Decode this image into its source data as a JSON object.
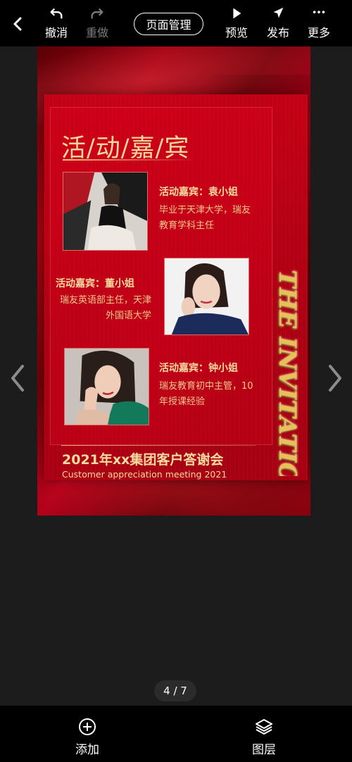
{
  "toolbar": {
    "undo_label": "撤消",
    "redo_label": "重做",
    "page_manage_label": "页面管理",
    "preview_label": "预览",
    "publish_label": "发布",
    "more_label": "更多"
  },
  "poster": {
    "title": "活/动/嘉/宾",
    "guests": [
      {
        "name": "活动嘉宾：袁小姐",
        "desc": "毕业于天津大学，瑞友教育学科主任"
      },
      {
        "name": "活动嘉宾：董小姐",
        "desc": "瑞友英语部主任，天津外国语大学"
      },
      {
        "name": "活动嘉宾：钟小姐",
        "desc": "瑞友教育初中主管，10年授课经验"
      }
    ],
    "event_title": "2021年xx集团客户答谢会",
    "event_subtitle": "Customer appreciation meeting 2021",
    "invitation_text": "THE INVITATION"
  },
  "pager": {
    "text": "4 / 7",
    "current": 4,
    "total": 7
  },
  "bottombar": {
    "add_label": "添加",
    "layers_label": "图层"
  },
  "colors": {
    "toolbar_bg": "#000000",
    "canvas_red": "#c8001a",
    "gold_text": "#f6dba0",
    "app_bg": "#1c1c1c"
  }
}
